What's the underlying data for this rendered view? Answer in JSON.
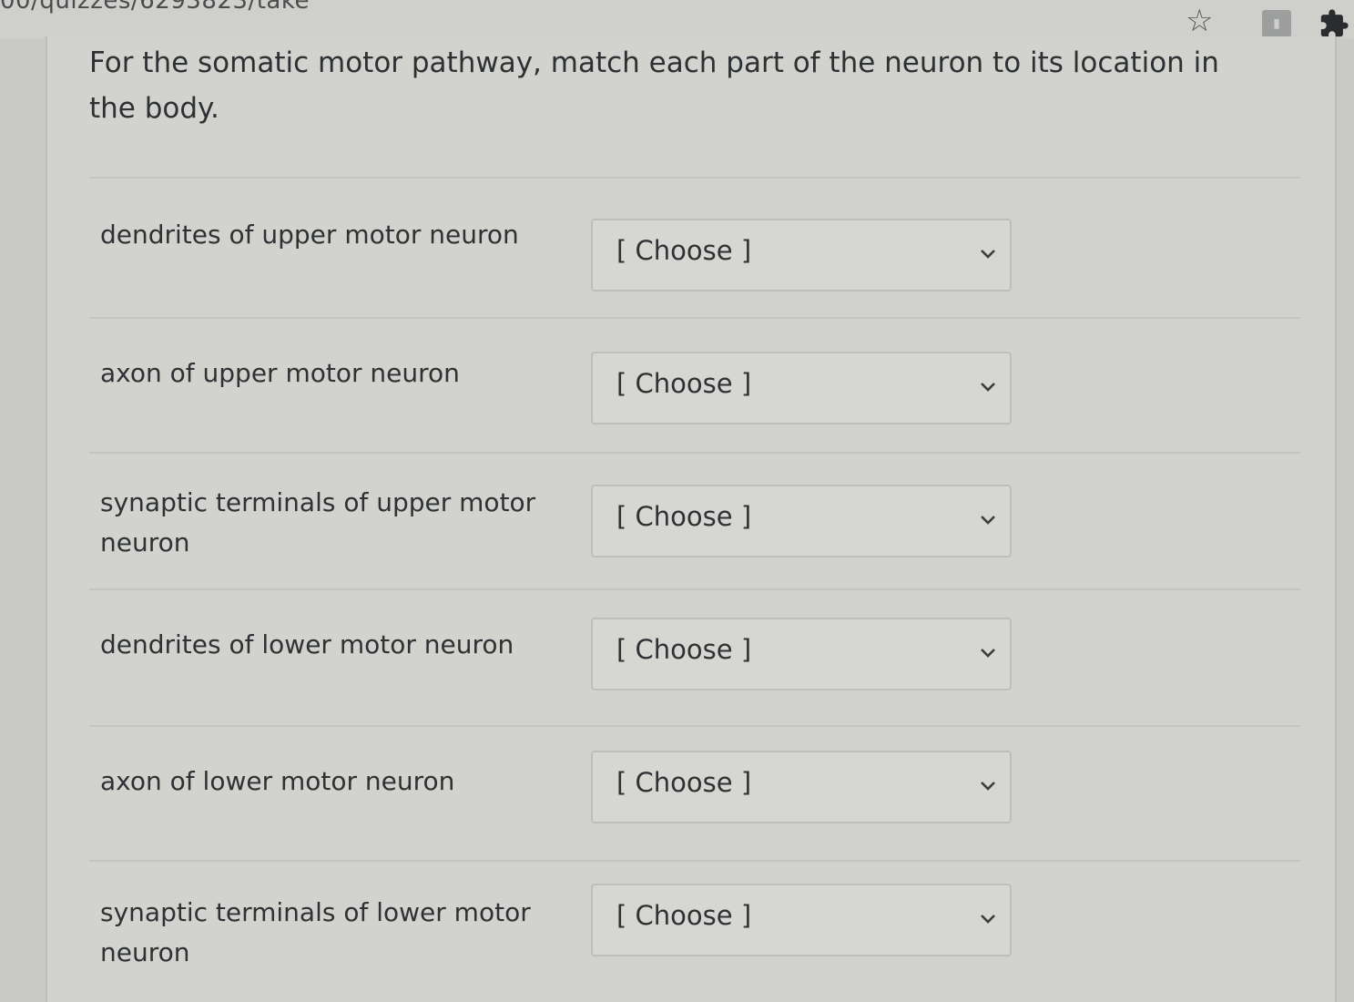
{
  "browser": {
    "url": "00/quizzes/6293823/take"
  },
  "question": {
    "text": "For the somatic motor pathway, match each part of the neuron to its location in the body."
  },
  "matches": [
    {
      "label": "dendrites of upper motor neuron",
      "selected": "[ Choose ]"
    },
    {
      "label": "axon of upper motor neuron",
      "selected": "[ Choose ]"
    },
    {
      "label": "synaptic terminals of upper motor neuron",
      "selected": "[ Choose ]"
    },
    {
      "label": "dendrites of lower motor neuron",
      "selected": "[ Choose ]"
    },
    {
      "label": "axon of lower motor neuron",
      "selected": "[ Choose ]"
    },
    {
      "label": "synaptic terminals of lower motor neuron",
      "selected": "[ Choose ]"
    }
  ]
}
